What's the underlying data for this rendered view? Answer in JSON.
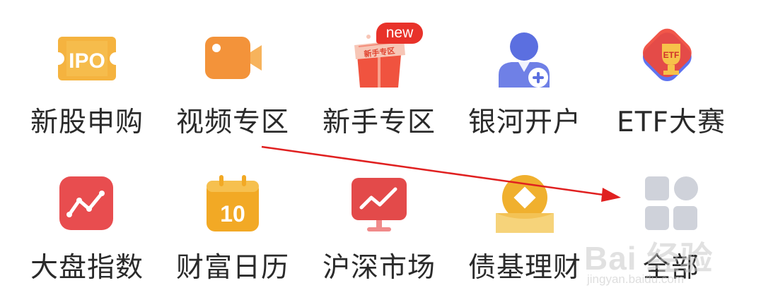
{
  "menu": {
    "rows": [
      [
        {
          "label": "新股申购",
          "icon": "ipo-ticket-icon"
        },
        {
          "label": "视频专区",
          "icon": "video-camera-icon"
        },
        {
          "label": "新手专区",
          "icon": "newbie-giftbox-icon",
          "icon_text": "新手专区",
          "badge": "new"
        },
        {
          "label": "银河开户",
          "icon": "open-account-user-icon"
        },
        {
          "label": "ETF大赛",
          "icon": "etf-trophy-icon",
          "icon_text": "ETF"
        }
      ],
      [
        {
          "label": "大盘指数",
          "icon": "market-index-icon"
        },
        {
          "label": "财富日历",
          "icon": "calendar-icon",
          "icon_text": "10"
        },
        {
          "label": "沪深市场",
          "icon": "stock-monitor-icon"
        },
        {
          "label": "债基理财",
          "icon": "bond-coin-icon"
        },
        {
          "label": "全部",
          "icon": "all-grid-icon"
        }
      ]
    ],
    "ipo_icon_text": "IPO"
  },
  "watermark": {
    "main": "Bai 经验",
    "sub": "jingyan.baidu.com"
  },
  "colors": {
    "ipo": "#f5b33f",
    "video": "#f3933a",
    "newbie": "#f0533f",
    "account": "#5b6fe0",
    "etf": "#f0483a",
    "index": "#e84d4f",
    "calendar": "#f2a925",
    "monitor": "#e34a4a",
    "bond": "#f0b02e",
    "all": "#c9ccd6",
    "badge": "#e8322a",
    "arrow": "#e02020"
  }
}
